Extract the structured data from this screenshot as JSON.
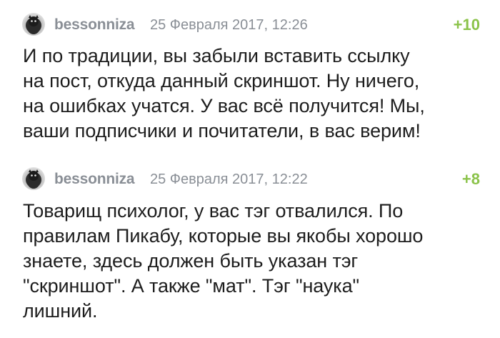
{
  "comments": [
    {
      "username": "bessonniza",
      "date": "25 Февраля 2017, 12:26",
      "rating": "+10",
      "text": "И по традиции, вы забыли вставить ссылку\nна пост, откуда данный скриншот. Ну ничего,\nна ошибках учатся. У вас всё получится! Мы,\nваши подписчики и почитатели, в вас верим!"
    },
    {
      "username": "bessonniza",
      "date": "25 Февраля 2017, 12:22",
      "rating": "+8",
      "text": "Товарищ психолог, у вас тэг отвалился. По\nправилам Пикабу, которые вы якобы хорошо\nзнаете, здесь должен быть указан тэг\n\"скриншот\". А также \"мат\". Тэг \"наука\"\nлишний."
    }
  ],
  "colors": {
    "meta": "#8a8f96",
    "rating_positive": "#8bc34a",
    "text": "#1e1e1e"
  },
  "icons": {
    "avatar": "user-avatar-icon"
  }
}
